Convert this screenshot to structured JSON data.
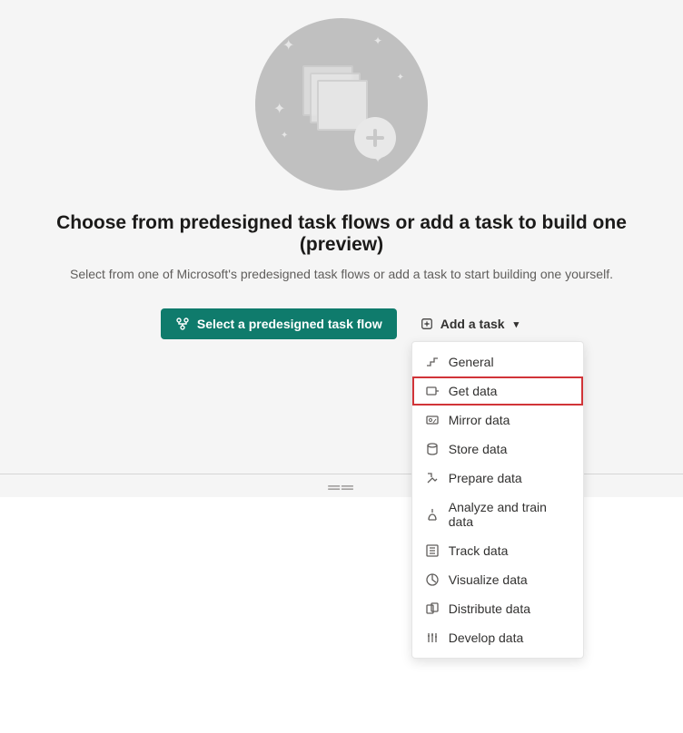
{
  "heading": "Choose from predesigned task flows or add a task to build one (preview)",
  "subheading": "Select from one of Microsoft's predesigned task flows or add a task to start building one yourself.",
  "primary_button": "Select a predesigned task flow",
  "secondary_button": "Add a task",
  "dropdown": {
    "items": [
      {
        "label": "General",
        "icon": "step"
      },
      {
        "label": "Get data",
        "icon": "data-in",
        "highlighted": true
      },
      {
        "label": "Mirror data",
        "icon": "mirror"
      },
      {
        "label": "Store data",
        "icon": "store"
      },
      {
        "label": "Prepare data",
        "icon": "prepare"
      },
      {
        "label": "Analyze and train data",
        "icon": "analyze"
      },
      {
        "label": "Track data",
        "icon": "track"
      },
      {
        "label": "Visualize data",
        "icon": "visualize"
      },
      {
        "label": "Distribute data",
        "icon": "distribute"
      },
      {
        "label": "Develop data",
        "icon": "develop"
      }
    ]
  }
}
